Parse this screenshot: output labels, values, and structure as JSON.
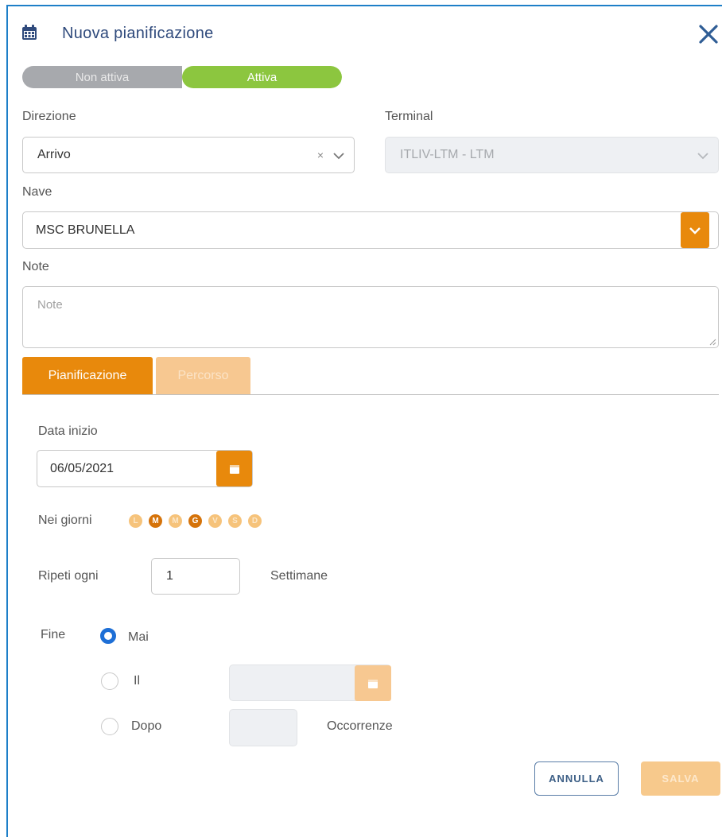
{
  "dialog": {
    "title": "Nuova pianificazione",
    "icons": {
      "header": "calendar-icon",
      "close": "close-icon"
    }
  },
  "status_toggle": {
    "off_label": "Non attiva",
    "on_label": "Attiva",
    "selected": "Attiva"
  },
  "direzione": {
    "label": "Direzione",
    "value": "Arrivo",
    "clear_symbol": "×"
  },
  "terminal": {
    "label": "Terminal",
    "value": "ITLIV-LTM - LTM"
  },
  "nave": {
    "label": "Nave",
    "value": "MSC BRUNELLA"
  },
  "note": {
    "label": "Note",
    "placeholder": "Note"
  },
  "tabs": [
    {
      "label": "Pianificazione",
      "active": true
    },
    {
      "label": "Percorso",
      "active": false
    }
  ],
  "schedule": {
    "start_label": "Data inizio",
    "start_value": "06/05/2021",
    "days_label": "Nei giorni",
    "days": [
      {
        "letter": "L",
        "selected": false
      },
      {
        "letter": "M",
        "selected": true
      },
      {
        "letter": "M",
        "selected": false
      },
      {
        "letter": "G",
        "selected": true
      },
      {
        "letter": "V",
        "selected": false
      },
      {
        "letter": "S",
        "selected": false
      },
      {
        "letter": "D",
        "selected": false
      }
    ],
    "repeat_label": "Ripeti ogni",
    "repeat_value": "1",
    "repeat_unit": "Settimane",
    "end_label": "Fine",
    "end_options": [
      {
        "label": "Mai",
        "checked": true
      },
      {
        "label": "Il",
        "checked": false
      },
      {
        "label": "Dopo",
        "checked": false
      }
    ],
    "occurrences_label": "Occorrenze"
  },
  "actions": {
    "cancel": "ANNULLA",
    "save": "SALVA"
  },
  "colors": {
    "accent": "#e8890c",
    "accent_light": "#f7c891",
    "active_green": "#8cc63f",
    "inactive_gray": "#a7a9ad",
    "title_blue": "#2f4a7c",
    "radio_blue": "#1e6fd6"
  }
}
